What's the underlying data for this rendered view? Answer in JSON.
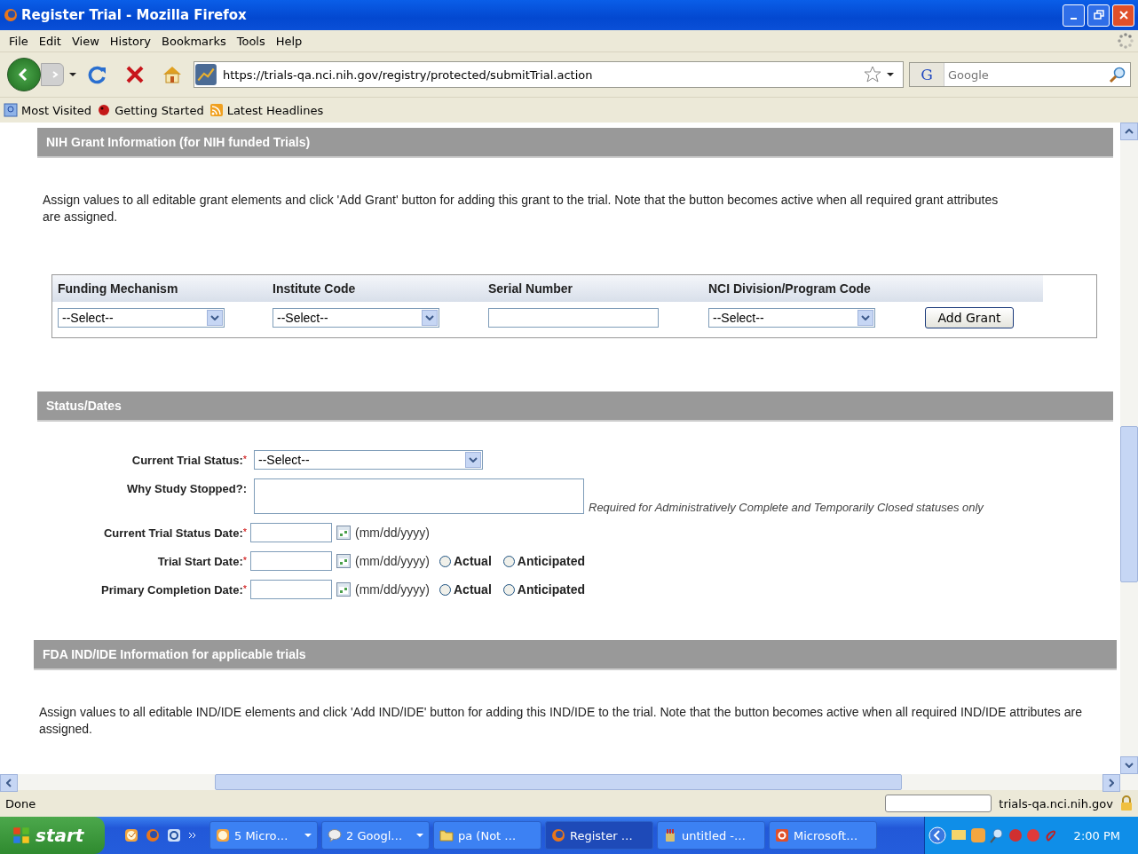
{
  "window": {
    "title": "Register Trial - Mozilla Firefox"
  },
  "menu": [
    "File",
    "Edit",
    "View",
    "History",
    "Bookmarks",
    "Tools",
    "Help"
  ],
  "navigation": {
    "url": "https://trials-qa.nci.nih.gov/registry/protected/submitTrial.action",
    "search_engine": "G",
    "search_placeholder": "Google"
  },
  "bookmarks": [
    "Most Visited",
    "Getting Started",
    "Latest Headlines"
  ],
  "grant_section": {
    "title": "NIH Grant Information (for NIH funded Trials)",
    "intro": "Assign values to all editable grant elements and click 'Add Grant' button for adding this grant to the trial. Note that the button becomes active when all required grant attributes are assigned.",
    "columns": [
      {
        "heading": "Funding Mechanism",
        "kind": "select",
        "value": "--Select--"
      },
      {
        "heading": "Institute Code",
        "kind": "select",
        "value": "--Select--"
      },
      {
        "heading": "Serial Number",
        "kind": "text"
      },
      {
        "heading": "NCI Division/Program Code",
        "kind": "select",
        "value": "--Select--"
      }
    ],
    "button": "Add Grant"
  },
  "status_section": {
    "title": "Status/Dates",
    "fields": [
      {
        "kind": "select",
        "label": "Current Trial Status:",
        "required_mark": "*",
        "value": "--Select--"
      },
      {
        "kind": "textarea",
        "label": "Why Study Stopped?:",
        "note": "Required for Administratively Complete and Temporarily Closed statuses only"
      },
      {
        "kind": "date",
        "label": "Current Trial Status Date:",
        "required_mark": "*",
        "format": "(mm/dd/yyyy)"
      },
      {
        "kind": "date",
        "label": "Trial Start Date:",
        "required_mark": "*",
        "format": "(mm/dd/yyyy)",
        "options": [
          {
            "label": "Actual",
            "selected": false
          },
          {
            "label": "Anticipated",
            "selected": false
          }
        ]
      },
      {
        "kind": "date",
        "label": "Primary Completion Date:",
        "required_mark": "*",
        "format": "(mm/dd/yyyy)",
        "options": [
          {
            "label": "Actual",
            "selected": false
          },
          {
            "label": "Anticipated",
            "selected": false
          }
        ]
      }
    ]
  },
  "fda_section": {
    "title": "FDA IND/IDE Information for applicable trials",
    "intro": "Assign values to all editable IND/IDE elements and click 'Add IND/IDE' button for adding this IND/IDE to the trial. Note that the button becomes active when all required IND/IDE attributes are assigned."
  },
  "status_bar": {
    "text": "Done",
    "site": "trials-qa.nci.nih.gov"
  },
  "taskbar": {
    "start": "start",
    "tasks": [
      {
        "label": "5 Micro…",
        "selected": false
      },
      {
        "label": "2 Googl…",
        "selected": false
      },
      {
        "label": "pa (Not …",
        "selected": false
      },
      {
        "label": "Register …",
        "selected": true
      },
      {
        "label": "untitled -…",
        "selected": false
      },
      {
        "label": "Microsoft…",
        "selected": false
      }
    ],
    "clock": "2:00 PM"
  }
}
